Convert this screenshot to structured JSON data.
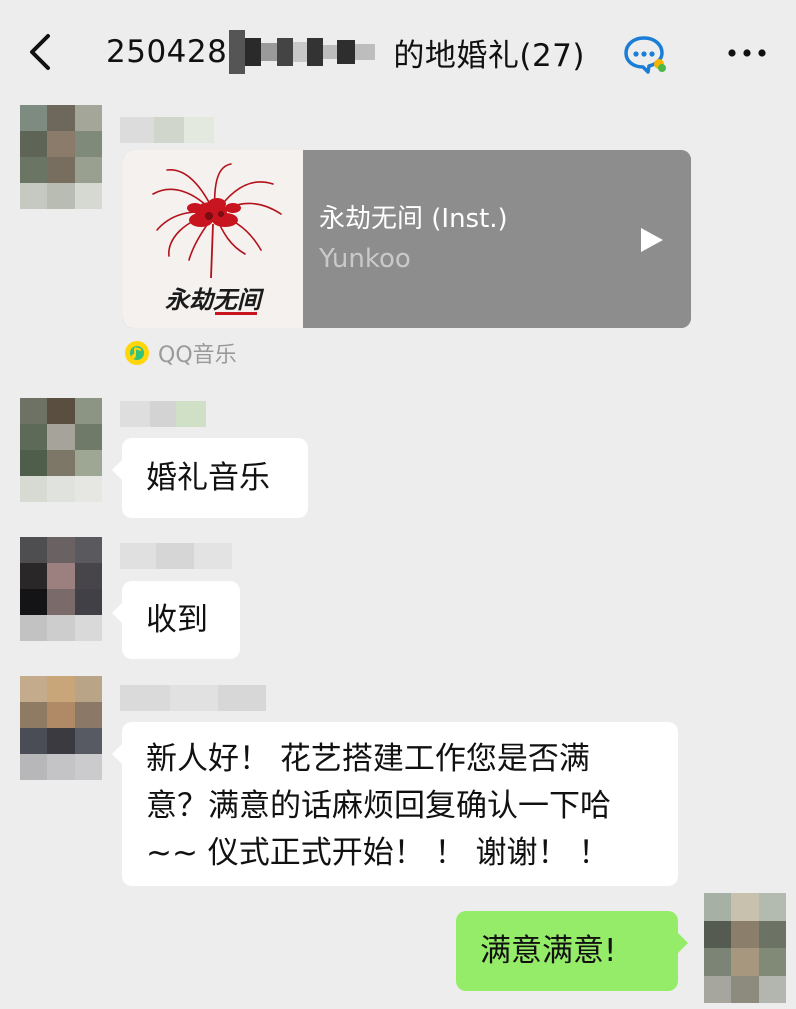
{
  "header": {
    "title_prefix": "250428",
    "title_suffix": "的地婚礼(27)",
    "back_icon": "chevron-left-icon",
    "chat_icon": "group-chat-icon",
    "more_icon": "more-dots-icon"
  },
  "messages": [
    {
      "type": "music",
      "song_title": "永劫无间 (Inst.)",
      "artist": "Yunkoo",
      "source": "QQ音乐",
      "cover_logo_text": "永劫无间"
    },
    {
      "type": "text",
      "lines": [
        "婚礼音乐"
      ]
    },
    {
      "type": "text",
      "lines": [
        "收到"
      ]
    },
    {
      "type": "text",
      "lines": [
        "新人好！ 花艺搭建工作您是否满",
        "意？满意的话麻烦回复确认一下哈",
        "~~ 仪式正式开始！ ！ 谢谢！ ！"
      ]
    },
    {
      "type": "text",
      "from_me": true,
      "lines": [
        "满意满意!"
      ]
    }
  ],
  "colors": {
    "background": "#ededed",
    "bubble_in": "#ffffff",
    "bubble_out": "#95ec69",
    "music_card": "#8d8d8d"
  }
}
